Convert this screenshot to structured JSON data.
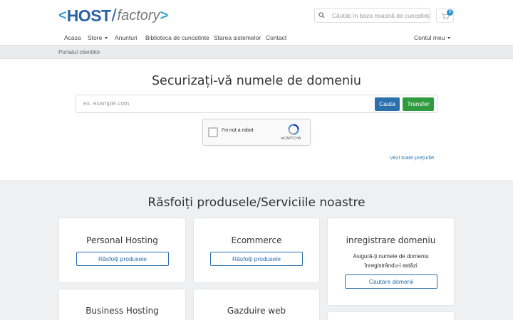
{
  "header": {
    "logo": {
      "lt": "<",
      "host": "HOST",
      "slash": "/",
      "factory": "factory",
      "gt": ">"
    },
    "search_placeholder": "Căutați în baza noastră de cunoștințe",
    "cart_count": "0"
  },
  "nav": {
    "items": [
      {
        "label": "Acasa"
      },
      {
        "label": "Store"
      },
      {
        "label": "Anunturi"
      },
      {
        "label": "Biblioteca de cunostinte"
      },
      {
        "label": "Starea sistemelor"
      },
      {
        "label": "Contact"
      }
    ],
    "account_label": "Contul meu"
  },
  "breadcrumb": "Portalul clientilor",
  "domain": {
    "title": "Securizați-vă numele de domeniu",
    "placeholder": "ex. example.com",
    "search_button": "Cauta",
    "transfer_button": "Transfer",
    "captcha_label": "I'm not a robot",
    "captcha_brand": "reCAPTCHA",
    "prices_link": "Vezi toate prețurile"
  },
  "products": {
    "title": "Răsfoiți produsele/Serviciile noastre",
    "cards": [
      {
        "title": "Personal Hosting",
        "button": "Răsfoiți produsele"
      },
      {
        "title": "Ecommerce",
        "button": "Răsfoiți produsele"
      },
      {
        "title": "inregistrare domeniu",
        "desc1": "Asigură-ți numele de domeniu",
        "desc2": "înregistrându-l astăzi",
        "button": "Cautare domenii"
      },
      {
        "title": "Business Hosting"
      },
      {
        "title": "Gazduire web"
      }
    ]
  },
  "colors": {
    "primary": "#2c6fad",
    "success": "#2e9b3f",
    "link": "#2a7ab8",
    "logo_blue": "#2a62a6",
    "section_bg": "#eff0f2"
  },
  "icons": {
    "search": "search-icon",
    "cart": "cart-icon",
    "captcha": "recaptcha-icon"
  }
}
